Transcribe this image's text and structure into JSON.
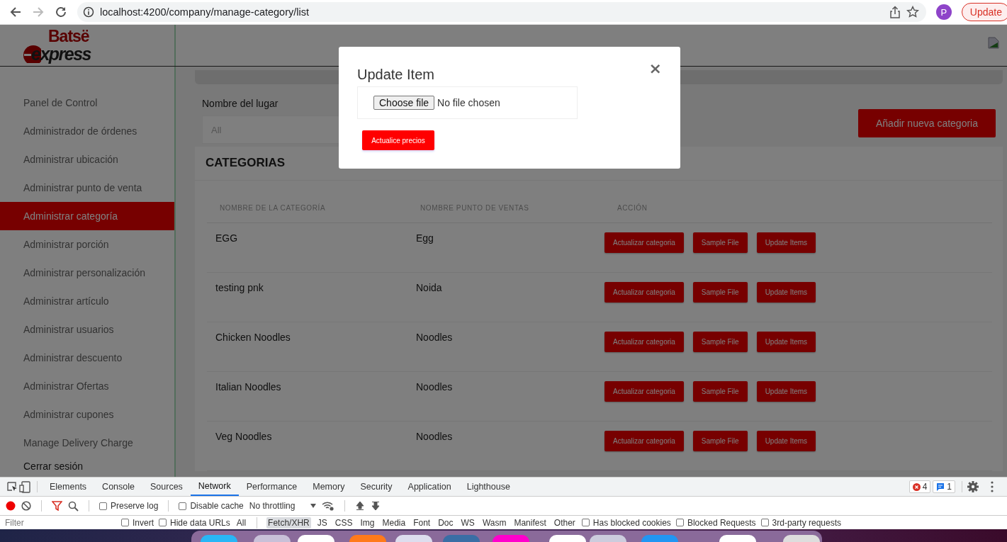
{
  "browser": {
    "url": "localhost:4200/company/manage-category/list",
    "profile_initial": "P",
    "update_label": "Update"
  },
  "logo": {
    "top": "Batsë",
    "bottom": "express"
  },
  "sidebar": {
    "items": [
      {
        "label": "Panel de Control",
        "selected": false
      },
      {
        "label": "Administrador de órdenes",
        "selected": false
      },
      {
        "label": "Administrar ubicación",
        "selected": false
      },
      {
        "label": "Administrar punto de venta",
        "selected": false
      },
      {
        "label": "Administrar categoría",
        "selected": true
      },
      {
        "label": "Administrar porción",
        "selected": false
      },
      {
        "label": "Administrar personalización",
        "selected": false
      },
      {
        "label": "Administrar artículo",
        "selected": false
      },
      {
        "label": "Administrar usuarios",
        "selected": false
      },
      {
        "label": "Administrar descuento",
        "selected": false
      },
      {
        "label": "Administrar Ofertas",
        "selected": false
      },
      {
        "label": "Administrar cupones",
        "selected": false
      },
      {
        "label": "Manage Delivery Charge",
        "selected": false
      }
    ],
    "logout": "Cerrar sesión"
  },
  "filter": {
    "label": "Nombre del lugar",
    "placeholder": "All"
  },
  "add_button": "Añadir nueva categoria",
  "card": {
    "title": "CATEGORIAS",
    "columns": [
      "NOMBRE DE LA CATEGORÍA",
      "NOMBRE PUNTO DE VENTAS",
      "ACCIÓN"
    ],
    "rows": [
      {
        "name": "EGG",
        "point_of_sale": "Egg",
        "actions": [
          "Actualizar categoria",
          "Sample File",
          "Update Items"
        ]
      },
      {
        "name": "testing pnk",
        "point_of_sale": "Noida",
        "actions": [
          "Actualizar categoria",
          "Sample File",
          "Update Items"
        ]
      },
      {
        "name": "Chicken Noodles",
        "point_of_sale": "Noodles",
        "actions": [
          "Actualizar categoria",
          "Sample File",
          "Update Items"
        ]
      },
      {
        "name": "Italian Noodles",
        "point_of_sale": "Noodles",
        "actions": [
          "Actualizar categoria",
          "Sample File",
          "Update Items"
        ]
      },
      {
        "name": "Veg Noodles",
        "point_of_sale": "Noodles",
        "actions": [
          "Actualizar categoria",
          "Sample File",
          "Update Items"
        ]
      }
    ]
  },
  "modal": {
    "title": "Update Item",
    "close": "×",
    "file_button": "Choose file",
    "file_status": "No file chosen",
    "submit": "Actualice precios"
  },
  "devtools": {
    "tabs": [
      {
        "label": "Elements",
        "selected": false
      },
      {
        "label": "Console",
        "selected": false
      },
      {
        "label": "Sources",
        "selected": false
      },
      {
        "label": "Network",
        "selected": true
      },
      {
        "label": "Performance",
        "selected": false
      },
      {
        "label": "Memory",
        "selected": false
      },
      {
        "label": "Security",
        "selected": false
      },
      {
        "label": "Application",
        "selected": false
      },
      {
        "label": "Lighthouse",
        "selected": false
      }
    ],
    "errors": "4",
    "messages": "1",
    "preserve_log": {
      "label": "Preserve log",
      "checked": false
    },
    "disable_cache": {
      "label": "Disable cache",
      "checked": false
    },
    "throttling": "No throttling",
    "filter_placeholder": "Filter",
    "options_left": [
      {
        "label": "Invert",
        "checked": false
      },
      {
        "label": "Hide data URLs",
        "checked": false
      }
    ],
    "types": [
      {
        "label": "All",
        "selected": false
      },
      {
        "label": "Fetch/XHR",
        "selected": true
      },
      {
        "label": "JS",
        "selected": false
      },
      {
        "label": "CSS",
        "selected": false
      },
      {
        "label": "Img",
        "selected": false
      },
      {
        "label": "Media",
        "selected": false
      },
      {
        "label": "Font",
        "selected": false
      },
      {
        "label": "Doc",
        "selected": false
      },
      {
        "label": "WS",
        "selected": false
      },
      {
        "label": "Wasm",
        "selected": false
      },
      {
        "label": "Manifest",
        "selected": false
      },
      {
        "label": "Other",
        "selected": false
      }
    ],
    "options_right": [
      {
        "label": "Has blocked cookies",
        "checked": false
      },
      {
        "label": "Blocked Requests",
        "checked": false
      },
      {
        "label": "3rd-party requests",
        "checked": false
      }
    ]
  }
}
